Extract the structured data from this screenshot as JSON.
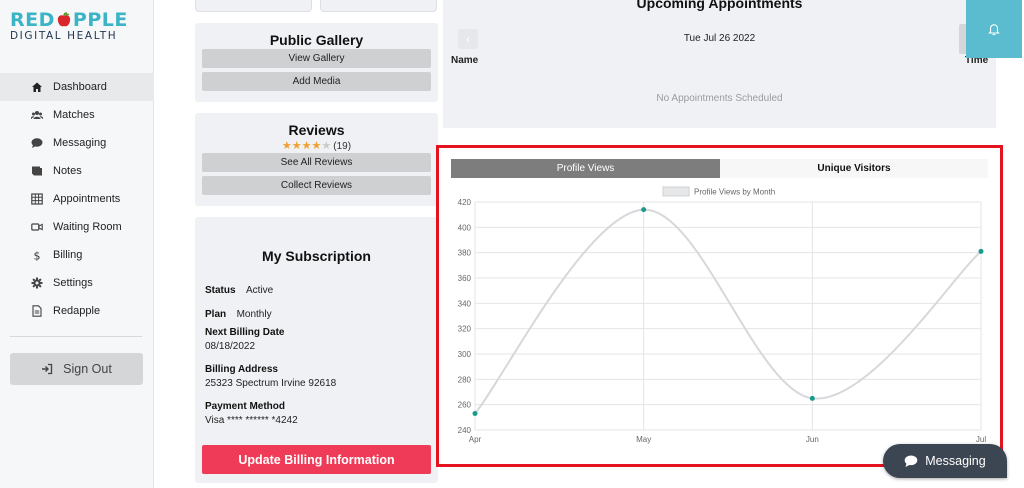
{
  "brand": {
    "logo_top_left": "RED",
    "logo_top_right": "PPLE",
    "logo_bottom": "DIGITAL HEALTH"
  },
  "sidebar": {
    "items": [
      {
        "label": "Dashboard",
        "icon": "home-icon",
        "active": true
      },
      {
        "label": "Matches",
        "icon": "users-icon"
      },
      {
        "label": "Messaging",
        "icon": "chat-bubble-icon"
      },
      {
        "label": "Notes",
        "icon": "notes-icon"
      },
      {
        "label": "Appointments",
        "icon": "calendar-grid-icon"
      },
      {
        "label": "Waiting Room",
        "icon": "video-camera-icon"
      },
      {
        "label": "Billing",
        "icon": "dollar-icon"
      },
      {
        "label": "Settings",
        "icon": "gear-icon"
      },
      {
        "label": "Redapple",
        "icon": "document-icon"
      }
    ],
    "sign_out": "Sign Out"
  },
  "gallery": {
    "title": "Public Gallery",
    "view_btn": "View Gallery",
    "add_btn": "Add Media"
  },
  "reviews": {
    "title": "Reviews",
    "rating": 4,
    "count": "(19)",
    "see_all_btn": "See All Reviews",
    "collect_btn": "Collect Reviews"
  },
  "subscription": {
    "title": "My Subscription",
    "status_label": "Status",
    "status_value": "Active",
    "plan_label": "Plan",
    "plan_value": "Monthly",
    "next_billing_label": "Next Billing Date",
    "next_billing_value": "08/18/2022",
    "address_label": "Billing Address",
    "address_value": "25323 Spectrum Irvine 92618",
    "payment_label": "Payment Method",
    "payment_value": "Visa **** ****** *4242",
    "update_btn": "Update Billing Information"
  },
  "appointments": {
    "title": "Upcoming Appointments",
    "date": "Tue Jul 26 2022",
    "col_name": "Name",
    "col_time": "Time",
    "empty": "No Appointments Scheduled",
    "prev_icon": "chevron-left-icon"
  },
  "tabs": {
    "profile_views": "Profile Views",
    "unique_visitors": "Unique Visitors"
  },
  "messaging_button": {
    "label": "Messaging",
    "icon": "chat-bubble-icon"
  },
  "colors": {
    "accent": "#5bbcd0",
    "brand_red": "#ef3b57",
    "highlight": "#e5131f",
    "line": "#d6d8dc",
    "point": "#1a9a8c"
  },
  "chart_data": {
    "type": "line",
    "categories": [
      "Apr",
      "May",
      "Jun",
      "Jul"
    ],
    "series": [
      {
        "name": "Profile Views by Month",
        "values": [
          253,
          414,
          265,
          381
        ]
      }
    ],
    "ylim": [
      240,
      420
    ],
    "yticks": [
      240,
      260,
      280,
      300,
      320,
      340,
      360,
      380,
      400,
      420
    ],
    "grid": true,
    "legend": "top-center"
  }
}
